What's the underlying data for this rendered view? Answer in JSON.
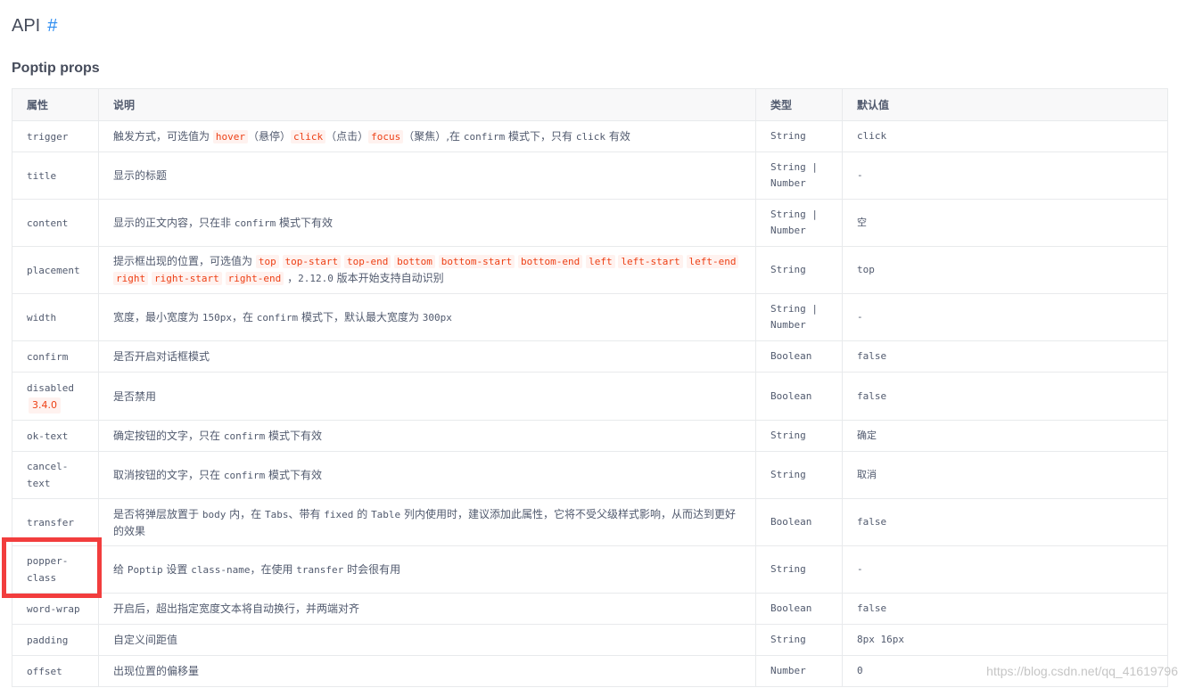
{
  "page": {
    "title": "API",
    "anchor": "#",
    "section_title": "Poptip props",
    "watermark": "https://blog.csdn.net/qq_41619796"
  },
  "table": {
    "headers": [
      "属性",
      "说明",
      "类型",
      "默认值"
    ],
    "rows": [
      {
        "prop": "trigger",
        "segments": [
          [
            "t",
            "触发方式，可选值为 "
          ],
          [
            "c",
            "hover"
          ],
          [
            "t",
            "（悬停）"
          ],
          [
            "c",
            "click"
          ],
          [
            "t",
            "（点击）"
          ],
          [
            "c",
            "focus"
          ],
          [
            "t",
            "（聚焦）,在 "
          ],
          [
            "m",
            "confirm"
          ],
          [
            "t",
            " 模式下，只有 "
          ],
          [
            "m",
            "click"
          ],
          [
            "t",
            " 有效"
          ]
        ],
        "type": "String",
        "default": "click",
        "height": 35
      },
      {
        "prop": "title",
        "segments": [
          [
            "t",
            "显示的标题"
          ]
        ],
        "type": "String | Number",
        "default": "-",
        "height": 53
      },
      {
        "prop": "content",
        "segments": [
          [
            "t",
            "显示的正文内容，只在非 "
          ],
          [
            "m",
            "confirm"
          ],
          [
            "t",
            " 模式下有效"
          ]
        ],
        "type": "String | Number",
        "default": "空",
        "height": 53
      },
      {
        "prop": "placement",
        "segments": [
          [
            "t",
            "提示框出现的位置，可选值为 "
          ],
          [
            "c",
            "top"
          ],
          [
            "t",
            " "
          ],
          [
            "c",
            "top-start"
          ],
          [
            "t",
            " "
          ],
          [
            "c",
            "top-end"
          ],
          [
            "t",
            " "
          ],
          [
            "c",
            "bottom"
          ],
          [
            "t",
            " "
          ],
          [
            "c",
            "bottom-start"
          ],
          [
            "t",
            " "
          ],
          [
            "c",
            "bottom-end"
          ],
          [
            "t",
            " "
          ],
          [
            "c",
            "left"
          ],
          [
            "t",
            " "
          ],
          [
            "c",
            "left-start"
          ],
          [
            "t",
            " "
          ],
          [
            "c",
            "left-end"
          ],
          [
            "t",
            " "
          ],
          [
            "c",
            "right"
          ],
          [
            "t",
            " "
          ],
          [
            "c",
            "right-start"
          ],
          [
            "t",
            " "
          ],
          [
            "c",
            "right-end"
          ],
          [
            "t",
            " ，"
          ],
          [
            "m",
            "2.12.0"
          ],
          [
            "t",
            " 版本开始支持自动识别"
          ]
        ],
        "type": "String",
        "default": "top",
        "height": 53
      },
      {
        "prop": "width",
        "segments": [
          [
            "t",
            "宽度，最小宽度为 "
          ],
          [
            "m",
            "150px"
          ],
          [
            "t",
            "，在 "
          ],
          [
            "m",
            "confirm"
          ],
          [
            "t",
            " 模式下，默认最大宽度为 "
          ],
          [
            "m",
            "300px"
          ]
        ],
        "type": "String | Number",
        "default": "-",
        "height": 53
      },
      {
        "prop": "confirm",
        "segments": [
          [
            "t",
            "是否开启对话框模式"
          ]
        ],
        "type": "Boolean",
        "default": "false",
        "height": 35
      },
      {
        "prop": "disabled",
        "version": "3.4.0",
        "segments": [
          [
            "t",
            "是否禁用"
          ]
        ],
        "type": "Boolean",
        "default": "false",
        "height": 54
      },
      {
        "prop": "ok-text",
        "segments": [
          [
            "t",
            "确定按钮的文字，只在 "
          ],
          [
            "m",
            "confirm"
          ],
          [
            "t",
            " 模式下有效"
          ]
        ],
        "type": "String",
        "default": "确定",
        "height": 35
      },
      {
        "prop": "cancel-text",
        "segments": [
          [
            "t",
            "取消按钮的文字，只在 "
          ],
          [
            "m",
            "confirm"
          ],
          [
            "t",
            " 模式下有效"
          ]
        ],
        "type": "String",
        "default": "取消",
        "height": 53
      },
      {
        "prop": "transfer",
        "segments": [
          [
            "t",
            "是否将弹层放置于 "
          ],
          [
            "m",
            "body"
          ],
          [
            "t",
            " 内，在 "
          ],
          [
            "m",
            "Tabs"
          ],
          [
            "t",
            "、带有 "
          ],
          [
            "m",
            "fixed"
          ],
          [
            "t",
            " 的 "
          ],
          [
            "m",
            "Table"
          ],
          [
            "t",
            " 列内使用时，建议添加此属性，它将不受父级样式影响，从而达到更好的效果"
          ]
        ],
        "type": "Boolean",
        "default": "false",
        "height": 53
      },
      {
        "prop": "popper-class",
        "segments": [
          [
            "t",
            "给 "
          ],
          [
            "m",
            "Poptip"
          ],
          [
            "t",
            " 设置 "
          ],
          [
            "m",
            "class-name"
          ],
          [
            "t",
            "，在使用 "
          ],
          [
            "m",
            "transfer"
          ],
          [
            "t",
            " 时会很有用"
          ]
        ],
        "type": "String",
        "default": "-",
        "height": 53
      },
      {
        "prop": "word-wrap",
        "segments": [
          [
            "t",
            "开启后，超出指定宽度文本将自动换行，并两端对齐"
          ]
        ],
        "type": "Boolean",
        "default": "false",
        "height": 35
      },
      {
        "prop": "padding",
        "segments": [
          [
            "t",
            "自定义间距值"
          ]
        ],
        "type": "String",
        "default": "8px 16px",
        "height": 35
      },
      {
        "prop": "offset",
        "segments": [
          [
            "t",
            "出现位置的偏移量"
          ]
        ],
        "type": "Number",
        "default": "0",
        "height": 35
      }
    ]
  },
  "annotation": {
    "highlighted_row": "popper-class",
    "color": "#f23d3d"
  },
  "colors": {
    "code": "#ed3f14",
    "code_bg": "#fff2ef",
    "border": "#e8eaec",
    "header_bg": "#f8f8f9",
    "anchor": "#2d8cf0"
  }
}
